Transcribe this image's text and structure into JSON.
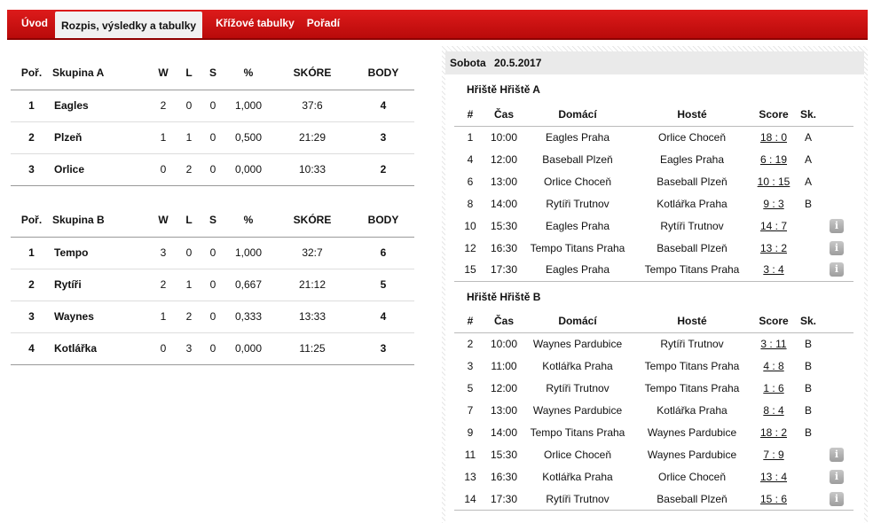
{
  "nav": {
    "tabs": [
      {
        "label": "Úvod"
      },
      {
        "label": "Rozpis, výsledky a tabulky"
      },
      {
        "label": "Křížové tabulky"
      },
      {
        "label": "Pořadí"
      }
    ]
  },
  "standings": {
    "columns": {
      "pos": "Poř.",
      "w": "W",
      "l": "L",
      "s": "S",
      "pct": "%",
      "score": "SKÓRE",
      "points": "BODY"
    },
    "groups": [
      {
        "name": "Skupina A",
        "rows": [
          {
            "pos": "1",
            "team": "Eagles",
            "w": "2",
            "l": "0",
            "s": "0",
            "pct": "1,000",
            "score": "37:6",
            "points": "4"
          },
          {
            "pos": "2",
            "team": "Plzeň",
            "w": "1",
            "l": "1",
            "s": "0",
            "pct": "0,500",
            "score": "21:29",
            "points": "3"
          },
          {
            "pos": "3",
            "team": "Orlice",
            "w": "0",
            "l": "2",
            "s": "0",
            "pct": "0,000",
            "score": "10:33",
            "points": "2"
          }
        ]
      },
      {
        "name": "Skupina B",
        "rows": [
          {
            "pos": "1",
            "team": "Tempo",
            "w": "3",
            "l": "0",
            "s": "0",
            "pct": "1,000",
            "score": "32:7",
            "points": "6"
          },
          {
            "pos": "2",
            "team": "Rytíři",
            "w": "2",
            "l": "1",
            "s": "0",
            "pct": "0,667",
            "score": "21:12",
            "points": "5"
          },
          {
            "pos": "3",
            "team": "Waynes",
            "w": "1",
            "l": "2",
            "s": "0",
            "pct": "0,333",
            "score": "13:33",
            "points": "4"
          },
          {
            "pos": "4",
            "team": "Kotlářka",
            "w": "0",
            "l": "3",
            "s": "0",
            "pct": "0,000",
            "score": "11:25",
            "points": "3"
          }
        ]
      }
    ]
  },
  "schedule": {
    "day": "Sobota",
    "date": "20.5.2017",
    "columns": {
      "num": "#",
      "time": "Čas",
      "home": "Domácí",
      "away": "Hosté",
      "score": "Score",
      "group": "Sk."
    },
    "info_icon": "info-icon",
    "fields": [
      {
        "title": "Hřiště Hřiště A",
        "games": [
          {
            "num": "1",
            "time": "10:00",
            "home": "Eagles Praha",
            "away": "Orlice Choceň",
            "score": "18 : 0",
            "group": "A",
            "info": false
          },
          {
            "num": "4",
            "time": "12:00",
            "home": "Baseball Plzeň",
            "away": "Eagles Praha",
            "score": "6 : 19",
            "group": "A",
            "info": false
          },
          {
            "num": "6",
            "time": "13:00",
            "home": "Orlice Choceň",
            "away": "Baseball Plzeň",
            "score": "10 : 15",
            "group": "A",
            "info": false
          },
          {
            "num": "8",
            "time": "14:00",
            "home": "Rytíři Trutnov",
            "away": "Kotlářka Praha",
            "score": "9 : 3",
            "group": "B",
            "info": false
          },
          {
            "num": "10",
            "time": "15:30",
            "home": "Eagles Praha",
            "away": "Rytíři Trutnov",
            "score": "14 : 7",
            "group": "",
            "info": true
          },
          {
            "num": "12",
            "time": "16:30",
            "home": "Tempo Titans Praha",
            "away": "Baseball Plzeň",
            "score": "13 : 2",
            "group": "",
            "info": true
          },
          {
            "num": "15",
            "time": "17:30",
            "home": "Eagles Praha",
            "away": "Tempo Titans Praha",
            "score": "3 : 4",
            "group": "",
            "info": true
          }
        ]
      },
      {
        "title": "Hřiště Hřiště B",
        "games": [
          {
            "num": "2",
            "time": "10:00",
            "home": "Waynes Pardubice",
            "away": "Rytíři Trutnov",
            "score": "3 : 11",
            "group": "B",
            "info": false
          },
          {
            "num": "3",
            "time": "11:00",
            "home": "Kotlářka Praha",
            "away": "Tempo Titans Praha",
            "score": "4 : 8",
            "group": "B",
            "info": false
          },
          {
            "num": "5",
            "time": "12:00",
            "home": "Rytíři Trutnov",
            "away": "Tempo Titans Praha",
            "score": "1 : 6",
            "group": "B",
            "info": false
          },
          {
            "num": "7",
            "time": "13:00",
            "home": "Waynes Pardubice",
            "away": "Kotlářka Praha",
            "score": "8 : 4",
            "group": "B",
            "info": false
          },
          {
            "num": "9",
            "time": "14:00",
            "home": "Tempo Titans Praha",
            "away": "Waynes Pardubice",
            "score": "18 : 2",
            "group": "B",
            "info": false
          },
          {
            "num": "11",
            "time": "15:30",
            "home": "Orlice Choceň",
            "away": "Waynes Pardubice",
            "score": "7 : 9",
            "group": "",
            "info": true
          },
          {
            "num": "13",
            "time": "16:30",
            "home": "Kotlářka Praha",
            "away": "Orlice Choceň",
            "score": "13 : 4",
            "group": "",
            "info": true
          },
          {
            "num": "14",
            "time": "17:30",
            "home": "Rytíři Trutnov",
            "away": "Baseball Plzeň",
            "score": "15 : 6",
            "group": "",
            "info": true
          }
        ]
      }
    ]
  }
}
